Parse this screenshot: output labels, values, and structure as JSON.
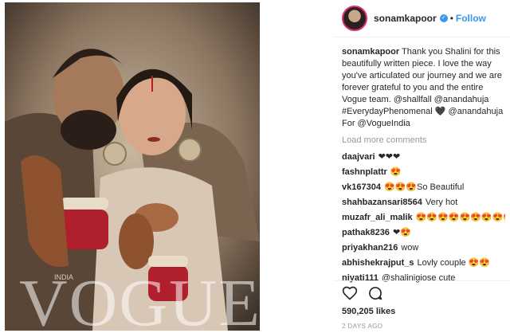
{
  "photo": {
    "masthead": "VOGUE",
    "edition": "INDIA"
  },
  "header": {
    "username": "sonamkapoor",
    "separator": "•",
    "follow_label": "Follow"
  },
  "caption": {
    "username": "sonamkapoor",
    "text": "Thank you Shalini for this beautifully written piece. I love the way you've articulated our journey and we are forever grateful to you and the entire Vogue team. @shallfall @anandahuja #EverydayPhenomenal 🖤 @anandahuja For @VogueIndia"
  },
  "load_more_label": "Load more comments",
  "comments": [
    {
      "user": "daajvari",
      "text": "❤❤❤"
    },
    {
      "user": "fashnplattr",
      "text": "😍"
    },
    {
      "user": "vk167304",
      "text": "😍😍😍So Beautiful"
    },
    {
      "user": "shahbazansari8564",
      "text": "Very hot"
    },
    {
      "user": "muzafr_ali_malik",
      "text": "😍😍😍😍😍😍😍😍😍😍😍😍"
    },
    {
      "user": "pathak8236",
      "text": "❤😍"
    },
    {
      "user": "priyakhan216",
      "text": "wow"
    },
    {
      "user": "abhishekrajput_s",
      "text": "Lovly couple 😍😍"
    },
    {
      "user": "niyati111",
      "text": "@shalinigiose cute"
    }
  ],
  "likes": "590,205 likes",
  "date": "2 DAYS AGO",
  "colors": {
    "link_blue": "#3897f0",
    "muted_gray": "#999999",
    "text": "#262626"
  },
  "icons": {
    "like": "heart-icon",
    "comment": "comment-icon",
    "verified": "verified-badge-icon"
  }
}
